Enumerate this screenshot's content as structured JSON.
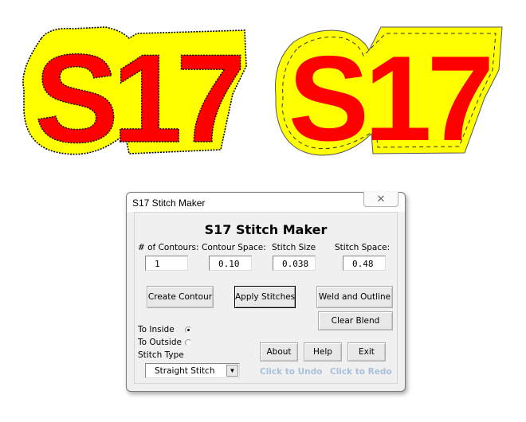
{
  "artwork": {
    "left": {
      "text": "S17",
      "style": "zigzag stitch contour",
      "fill_color": "#ff0000",
      "contour_color": "#ffff00",
      "stitch_color": "#000000"
    },
    "right": {
      "text": "S17",
      "style": "straight stitch contour",
      "fill_color": "#ff0000",
      "contour_color": "#ffff00",
      "stitch_color": "#333333"
    }
  },
  "window": {
    "title": "S17 Stitch Maker",
    "close_icon": "close-icon"
  },
  "panel": {
    "heading": "S17 Stitch Maker",
    "fields": [
      {
        "label": "# of Contours:",
        "value": "1"
      },
      {
        "label": "Contour Space:",
        "value": "0.10"
      },
      {
        "label": "Stitch Size",
        "value": "0.038"
      },
      {
        "label": "Stitch Space:",
        "value": "0.48"
      }
    ],
    "buttons": {
      "create_contour": "Create Contour",
      "apply_stitches": "Apply Stitches",
      "weld_outline": "Weld and Outline",
      "clear_blend": "Clear Blend",
      "about": "About",
      "help": "Help",
      "exit": "Exit"
    },
    "direction": {
      "inside_label": "To Inside",
      "outside_label": "To Outside",
      "selected": "To Inside"
    },
    "stitch_type": {
      "label": "Stitch Type",
      "selected": "Straight Stitch"
    },
    "links": {
      "undo": "Click to Undo",
      "redo": "Click to Redo",
      "color": "#a8c0dc"
    }
  }
}
